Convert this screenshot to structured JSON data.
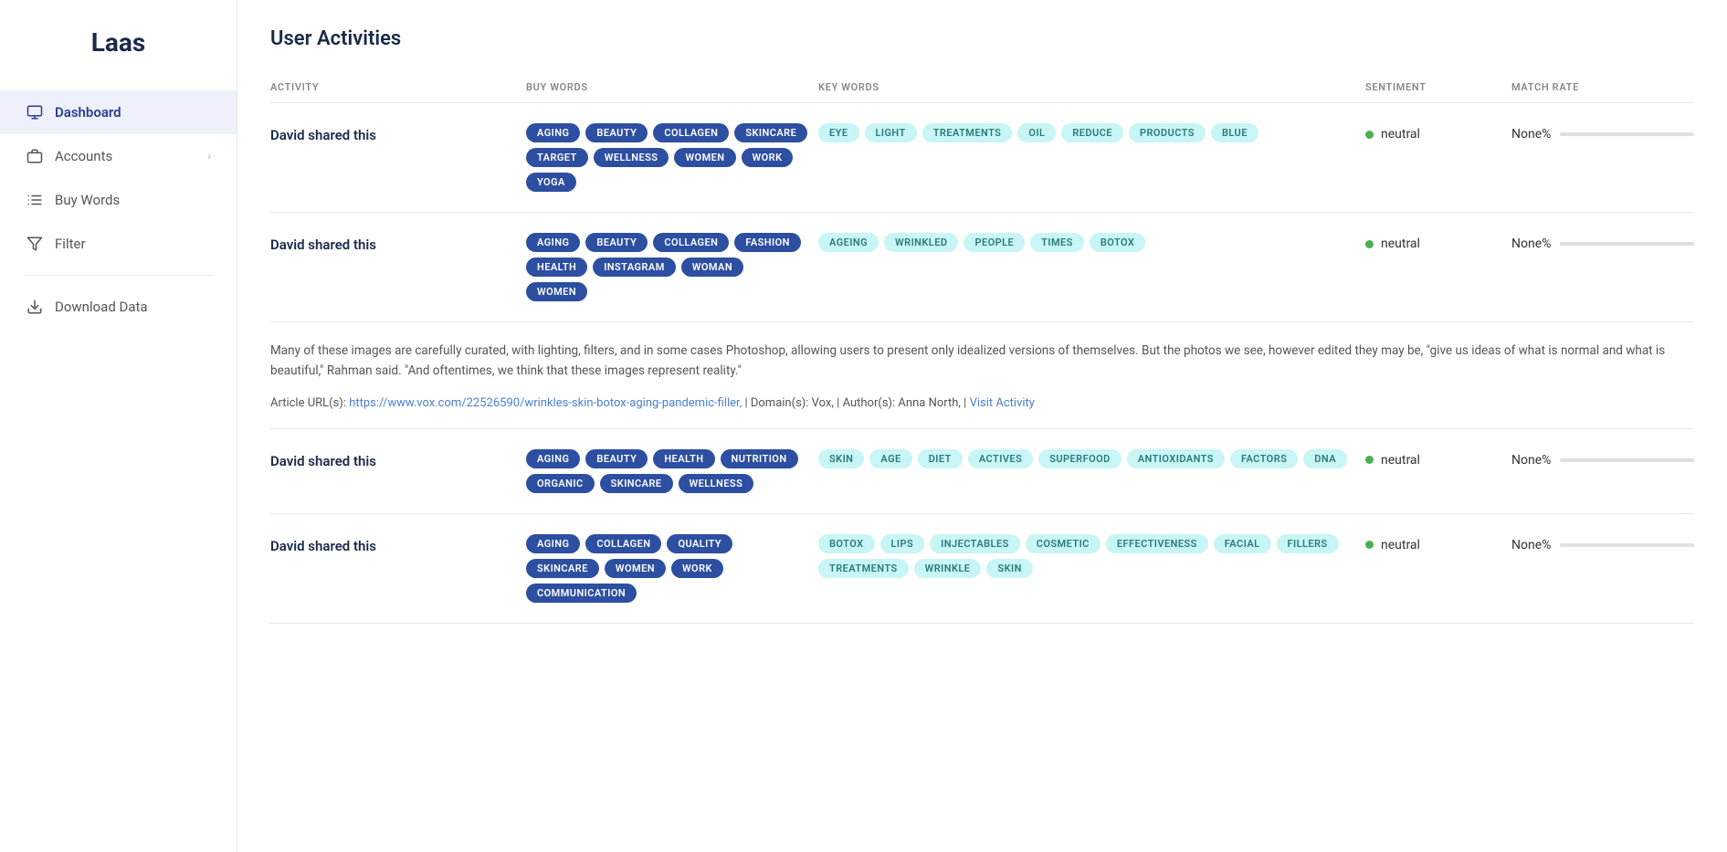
{
  "app": {
    "logo": "Laas"
  },
  "sidebar": {
    "items": [
      {
        "id": "dashboard",
        "label": "Dashboard",
        "icon": "monitor",
        "active": true,
        "hasChevron": false
      },
      {
        "id": "accounts",
        "label": "Accounts",
        "icon": "briefcase",
        "active": false,
        "hasChevron": true
      },
      {
        "id": "buy-words",
        "label": "Buy Words",
        "icon": "list",
        "active": false,
        "hasChevron": false
      },
      {
        "id": "filter",
        "label": "Filter",
        "icon": "filter",
        "active": false,
        "hasChevron": false
      },
      {
        "id": "download-data",
        "label": "Download Data",
        "icon": "download",
        "active": false,
        "hasChevron": false
      }
    ]
  },
  "main": {
    "page_title": "User Activities",
    "columns": [
      "ACTIVITY",
      "BUY WORDS",
      "KEY WORDS",
      "SENTIMENT",
      "MATCH RATE"
    ],
    "activities": [
      {
        "id": 1,
        "title": "David shared this",
        "buy_words": [
          "AGING",
          "BEAUTY",
          "COLLAGEN",
          "SKINCARE",
          "TARGET",
          "WELLNESS",
          "WOMEN",
          "WORK",
          "YOGA"
        ],
        "key_words": [
          "EYE",
          "LIGHT",
          "TREATMENTS",
          "OIL",
          "REDUCE",
          "PRODUCTS",
          "BLUE"
        ],
        "sentiment": "neutral",
        "match_rate": "None%"
      },
      {
        "id": 2,
        "title": "David shared this",
        "buy_words": [
          "AGING",
          "BEAUTY",
          "COLLAGEN",
          "FASHION",
          "HEALTH",
          "INSTAGRAM",
          "WOMAN",
          "WOMEN"
        ],
        "key_words": [
          "AGEING",
          "WRINKLED",
          "PEOPLE",
          "TIMES",
          "BOTOX"
        ],
        "sentiment": "neutral",
        "match_rate": "None%",
        "has_article": true,
        "article_text": "Many of these images are carefully curated, with lighting, filters, and in some cases Photoshop, allowing users to present only idealized versions of themselves. But the photos we see, however edited they may be, \"give us ideas of what is normal and what is beautiful,\" Rahman said. \"And oftentimes, we think that these images represent reality.\"",
        "article_url": "https://www.vox.com/22526590/wrinkles-skin-botox-aging-pandemic-filler,",
        "article_domain": "Vox,",
        "article_author": "Anna North,",
        "article_url_label": "https://www.vox.com/22526590/wrinkles-skin-botox-aging-pandemic-filler,",
        "visit_activity_label": "Visit Activity"
      },
      {
        "id": 3,
        "title": "David shared this",
        "buy_words": [
          "AGING",
          "BEAUTY",
          "HEALTH",
          "NUTRITION",
          "ORGANIC",
          "SKINCARE",
          "WELLNESS"
        ],
        "key_words": [
          "SKIN",
          "AGE",
          "DIET",
          "ACTIVES",
          "SUPERFOOD",
          "ANTIOXIDANTS",
          "FACTORS",
          "DNA"
        ],
        "sentiment": "neutral",
        "match_rate": "None%"
      },
      {
        "id": 4,
        "title": "David shared this",
        "buy_words": [
          "AGING",
          "COLLAGEN",
          "QUALITY",
          "SKINCARE",
          "WOMEN",
          "WORK",
          "COMMUNICATION"
        ],
        "key_words": [
          "BOTOX",
          "LIPS",
          "INJECTABLES",
          "COSMETIC",
          "EFFECTIVENESS",
          "FACIAL",
          "FILLERS",
          "TREATMENTS",
          "WRINKLE",
          "SKIN"
        ],
        "sentiment": "neutral",
        "match_rate": "None%"
      }
    ],
    "labels": {
      "article_url_prefix": "Article URL(s): ",
      "domain_prefix": "Domain(s): ",
      "author_prefix": "Author(s): ",
      "visit_activity": "Visit Activity"
    }
  }
}
